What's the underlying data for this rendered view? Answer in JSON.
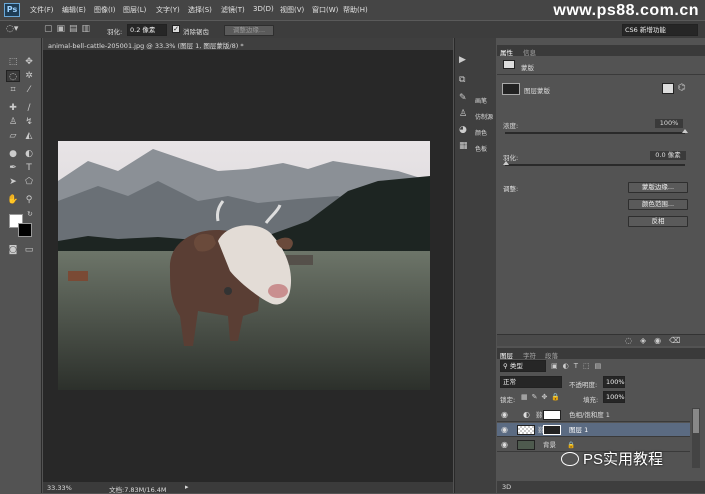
{
  "app": {
    "logo": "Ps"
  },
  "menubar": {
    "items": [
      "文件(F)",
      "编辑(E)",
      "图像(I)",
      "图层(L)",
      "文字(Y)",
      "选择(S)",
      "滤镜(T)",
      "3D(D)",
      "视图(V)",
      "窗口(W)",
      "帮助(H)"
    ]
  },
  "watermark": "www.ps88.com.cn",
  "options": {
    "feather_label": "羽化:",
    "feather_value": "0.2 像素",
    "antialias_label": "消除锯齿",
    "refine_label": "调整边缘...",
    "workspace": "CS6 新增功能"
  },
  "document": {
    "tab": "animal-bell-cattle-205001.jpg @ 33.3% (图层 1, 图层蒙版/8) *",
    "zoom": "33.33%",
    "doc_info": "文档:7.83M/16.4M"
  },
  "panel_dock": {
    "items": [
      "",
      "",
      "画笔",
      "仿制源",
      "颜色",
      "色板"
    ]
  },
  "properties": {
    "tabs": [
      "属性",
      "信息"
    ],
    "title": "蒙版",
    "mask_label": "图层蒙版",
    "density_label": "浓度:",
    "density_value": "100%",
    "feather_label": "羽化:",
    "feather_value": "0.0 像素",
    "adjust_label": "调整:",
    "buttons": [
      "蒙版边缘...",
      "颜色范围...",
      "反相"
    ],
    "density": 1.0
  },
  "layers_panel": {
    "tabs": [
      "图层",
      "字符",
      "段落"
    ],
    "filter_label": "类型",
    "blend_mode": "正常",
    "opacity_label": "不透明度:",
    "opacity_value": "100%",
    "lock_label": "锁定:",
    "fill_label": "填充:",
    "fill_value": "100%",
    "layers": [
      {
        "name": "色相/饱和度 1"
      },
      {
        "name": "图层 1"
      },
      {
        "name": "背景"
      }
    ]
  },
  "wechat_watermark": "PS实用教程",
  "bottom_right_label": "3D"
}
